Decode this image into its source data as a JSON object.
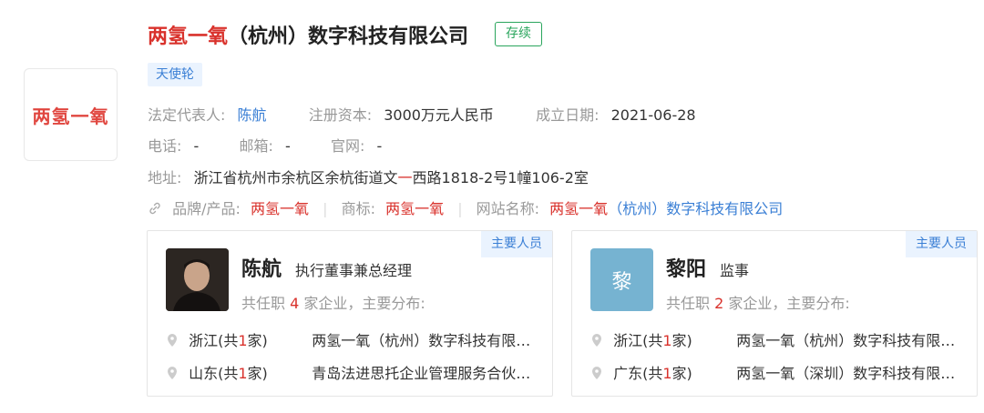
{
  "logo": {
    "text": "两氢一氧"
  },
  "company": {
    "name_part1": "两氢一氧",
    "name_part2": "（杭州）数字科技有限公司",
    "status": "存续",
    "round": "天使轮"
  },
  "info": {
    "legal_rep_label": "法定代表人:",
    "legal_rep": "陈航",
    "capital_label": "注册资本:",
    "capital": "3000万元人民币",
    "founded_label": "成立日期:",
    "founded": "2021-06-28",
    "phone_label": "电话:",
    "phone": "-",
    "email_label": "邮箱:",
    "email": "-",
    "website_label": "官网:",
    "website": "-",
    "address_label": "地址:",
    "address_a": "浙江省杭州市余杭区余杭街道文",
    "address_b": "一",
    "address_c": "西路1818-2号1幢106-2室",
    "brand_label": "品牌/产品:",
    "brand": "两氢一氧",
    "trademark_label": "商标:",
    "trademark": "两氢一氧",
    "site_name_label": "网站名称:",
    "site_name": "两氢一氧（杭州）数字科技有限公司"
  },
  "people": [
    {
      "tag": "主要人员",
      "name": "陈航",
      "role": "执行董事兼总经理",
      "tenure_a": "共任职 ",
      "tenure_num": "4",
      "tenure_b": " 家企业，主要分布:",
      "rows": [
        {
          "region_a": "浙江(共",
          "region_num": "1",
          "region_b": "家)",
          "company": "两氢一氧（杭州）数字科技有限公司"
        },
        {
          "region_a": "山东(共",
          "region_num": "1",
          "region_b": "家)",
          "company": "青岛法进思托企业管理服务合伙企业"
        }
      ]
    },
    {
      "tag": "主要人员",
      "name": "黎阳",
      "avatar_letter": "黎",
      "role": "监事",
      "tenure_a": "共任职 ",
      "tenure_num": "2",
      "tenure_b": " 家企业，主要分布:",
      "rows": [
        {
          "region_a": "浙江(共",
          "region_num": "1",
          "region_b": "家)",
          "company": "两氢一氧（杭州）数字科技有限公司"
        },
        {
          "region_a": "广东(共",
          "region_num": "1",
          "region_b": "家)",
          "company": "两氢一氧（深圳）数字科技有限公司"
        }
      ]
    }
  ],
  "colors": {
    "accent_red": "#d9322c",
    "link_blue": "#3a7fd5",
    "status_green": "#29a55c"
  }
}
